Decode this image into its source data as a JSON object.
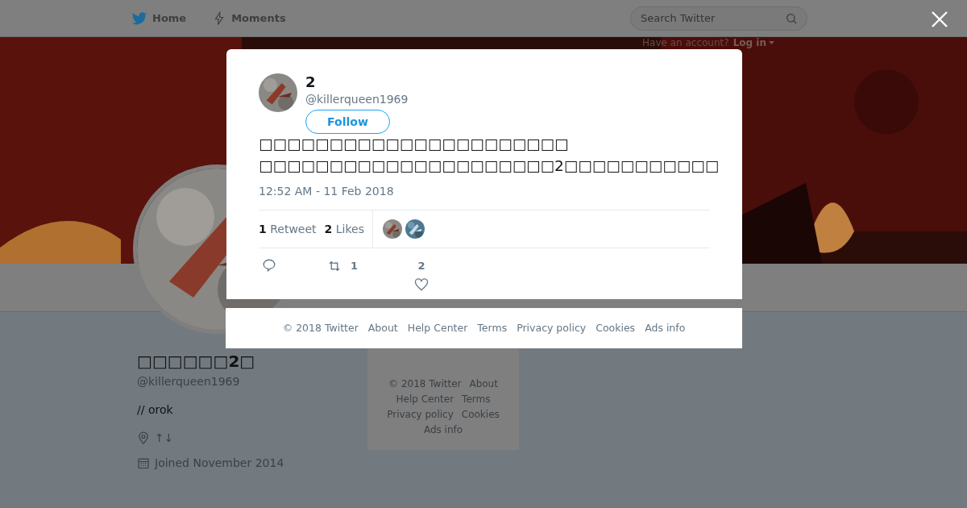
{
  "nav": {
    "items": [
      {
        "kind": "home",
        "label": "Home"
      },
      {
        "kind": "moments",
        "label": "Moments"
      }
    ],
    "search": {
      "placeholder": "Search Twitter"
    },
    "account_prompt": "Have an account?",
    "login": "Log in"
  },
  "profile": {
    "name": "□□□□□□2□",
    "handle": "@killerqueen1969",
    "bio": "// orok",
    "location": "↑↓",
    "joined": "Joined November 2014"
  },
  "side_footer": [
    "© 2018 Twitter",
    "About",
    "Help Center",
    "Terms",
    "Privacy policy",
    "Cookies",
    "Ads info"
  ],
  "tweet": {
    "name": "2",
    "handle": "@killerqueen1969",
    "follow": "Follow",
    "lines": [
      "□□□□□□□□□□□□□□□□□□□□□□",
      "□□□□□□□□□□□□□□□□□□□□□2□□□□□□□□□□□"
    ],
    "time": "12:52 AM - 11 Feb 2018",
    "stats": [
      {
        "count": "1",
        "label": "Retweet"
      },
      {
        "count": "2",
        "label": "Likes"
      }
    ],
    "actions": [
      {
        "kind": "reply"
      },
      {
        "kind": "retweet",
        "count": "1"
      },
      {
        "kind": "like",
        "count": "2"
      }
    ]
  },
  "footer": [
    "© 2018 Twitter",
    "About",
    "Help Center",
    "Terms",
    "Privacy policy",
    "Cookies",
    "Ads info"
  ]
}
